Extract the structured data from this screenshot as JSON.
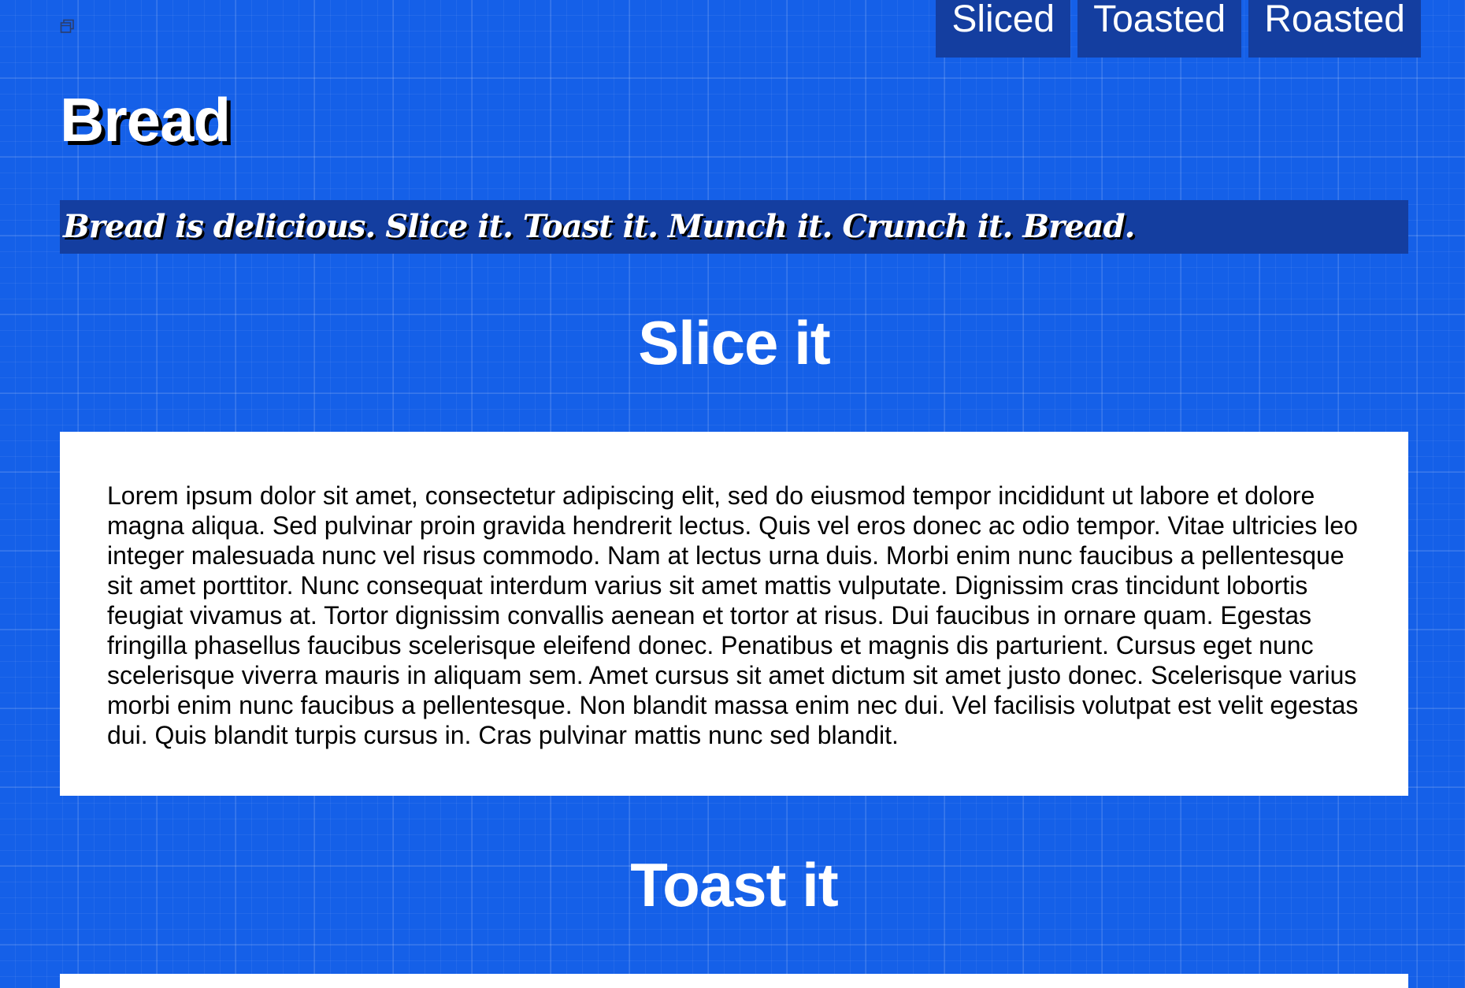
{
  "header": {
    "logo_icon": "window-icon",
    "title": "Bread",
    "tagline": "Bread is delicious. Slice it. Toast it. Munch it. Crunch it. Bread."
  },
  "nav": {
    "items": [
      {
        "label": "Sliced"
      },
      {
        "label": "Toasted"
      },
      {
        "label": "Roasted"
      }
    ]
  },
  "sections": [
    {
      "heading": "Slice it",
      "body": "Lorem ipsum dolor sit amet, consectetur adipiscing elit, sed do eiusmod tempor incididunt ut labore et dolore magna aliqua. Sed pulvinar proin gravida hendrerit lectus. Quis vel eros donec ac odio tempor. Vitae ultricies leo integer malesuada nunc vel risus commodo. Nam at lectus urna duis. Morbi enim nunc faucibus a pellentesque sit amet porttitor. Nunc consequat interdum varius sit amet mattis vulputate. Dignissim cras tincidunt lobortis feugiat vivamus at. Tortor dignissim convallis aenean et tortor at risus. Dui faucibus in ornare quam. Egestas fringilla phasellus faucibus scelerisque eleifend donec. Penatibus et magnis dis parturient. Cursus eget nunc scelerisque viverra mauris in aliquam sem. Amet cursus sit amet dictum sit amet justo donec. Scelerisque varius morbi enim nunc faucibus a pellentesque. Non blandit massa enim nec dui. Vel facilisis volutpat est velit egestas dui. Quis blandit turpis cursus in. Cras pulvinar mattis nunc sed blandit."
    },
    {
      "heading": "Toast it"
    }
  ],
  "colors": {
    "background": "#1560e8",
    "nav_background": "#143ea0",
    "tagline_background": "#143ea0",
    "card_background": "#ffffff",
    "heading_text": "#ffffff"
  }
}
